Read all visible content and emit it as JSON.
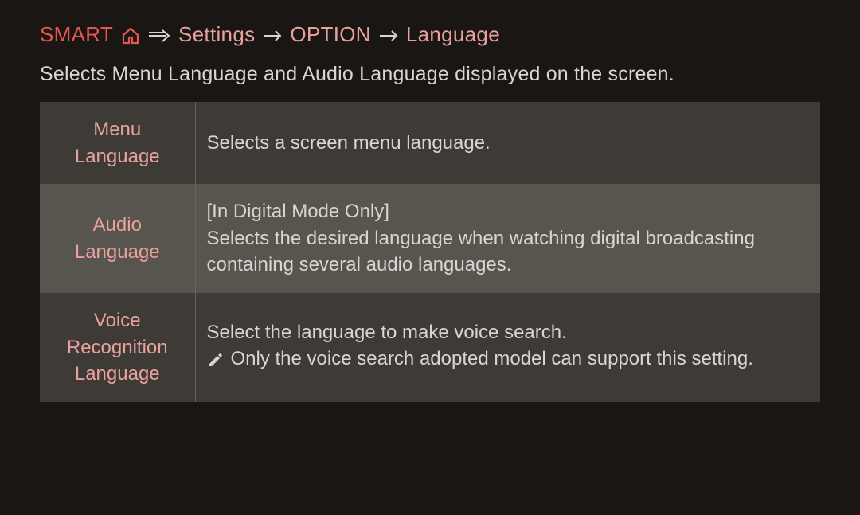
{
  "breadcrumb": {
    "smart": "SMART",
    "steps": [
      "Settings",
      "OPTION",
      "Language"
    ]
  },
  "description": "Selects Menu Language and Audio Language displayed on the screen.",
  "table": {
    "rows": [
      {
        "label": "Menu Language",
        "desc": "Selects a screen menu language."
      },
      {
        "label": "Audio Language",
        "desc_prefix": "[In Digital Mode Only]",
        "desc": "Selects the desired language when watching digital broadcasting containing several audio languages."
      },
      {
        "label": "Voice Recognition Language",
        "desc": "Select the language to make voice search.",
        "note": "Only the voice search adopted model can support this setting."
      }
    ]
  }
}
